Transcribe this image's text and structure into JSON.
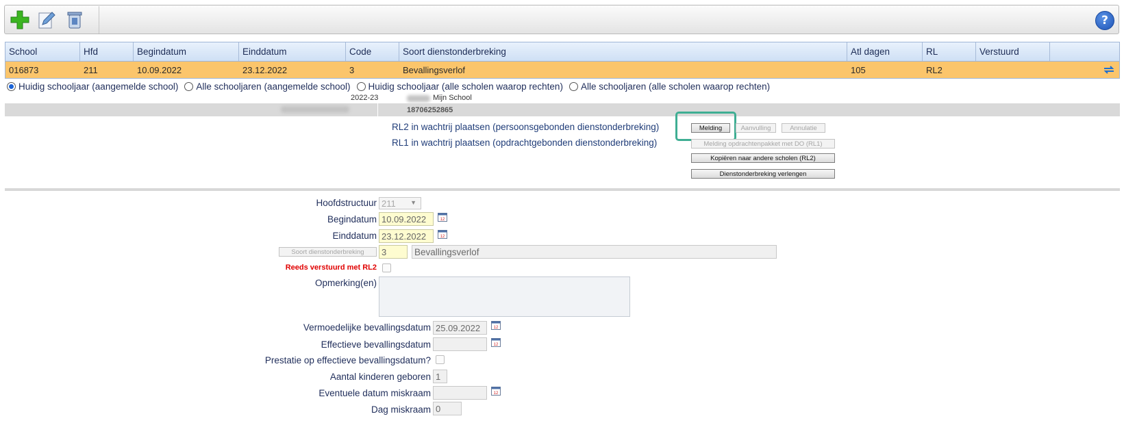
{
  "toolbar": {
    "icons": [
      "add-icon",
      "edit-icon",
      "delete-icon"
    ],
    "help_label": "?"
  },
  "grid": {
    "columns": [
      "School",
      "Hfd",
      "Begindatum",
      "Einddatum",
      "Code",
      "Soort dienstonderbreking",
      "Atl dagen",
      "RL",
      "Verstuurd"
    ],
    "row": [
      "016873",
      "211",
      "10.09.2022",
      "23.12.2022",
      "3",
      "Bevallingsverlof",
      "105",
      "RL2",
      ""
    ]
  },
  "filters": [
    {
      "label": "Huidig schooljaar (aangemelde school)",
      "selected": true
    },
    {
      "label": "Alle schooljaren (aangemelde school)",
      "selected": false
    },
    {
      "label": "Huidig schooljaar (alle scholen waarop rechten)",
      "selected": false
    },
    {
      "label": "Alle schooljaren (alle scholen waarop rechten)",
      "selected": false
    }
  ],
  "info": {
    "year": "2022-23",
    "school": "Mijn School",
    "number": "18706252865"
  },
  "actions": {
    "rl2_label": "RL2 in wachtrij plaatsen (persoonsgebonden dienstonderbreking)",
    "rl1_label": "RL1 in wachtrij plaatsen (opdrachtgebonden dienstonderbreking)",
    "melding": "Melding",
    "aanvulling": "Aanvulling",
    "annulatie": "Annulatie",
    "melding_rl1": "Melding opdrachtenpakket met DO (RL1)",
    "kopieren": "Kopiëren naar andere scholen (RL2)",
    "verlengen": "Dienstonderbreking verlengen"
  },
  "form": {
    "hoofdstructuur_label": "Hoofdstructuur",
    "hoofdstructuur_value": "211",
    "begindatum_label": "Begindatum",
    "begindatum_value": "10.09.2022",
    "einddatum_label": "Einddatum",
    "einddatum_value": "23.12.2022",
    "soort_button": "Soort dienstonderbreking",
    "soort_code": "3",
    "soort_name": "Bevallingsverlof",
    "reeds_label": "Reeds verstuurd met RL2",
    "opmerking_label": "Opmerking(en)",
    "vermoedelijke_label": "Vermoedelijke bevallingsdatum",
    "vermoedelijke_value": "25.09.2022",
    "effectieve_label": "Effectieve bevallingsdatum",
    "effectieve_value": "",
    "prestatie_label": "Prestatie op effectieve bevallingsdatum?",
    "kinderen_label": "Aantal kinderen geboren",
    "kinderen_value": "1",
    "miskraam_datum_label": "Eventuele datum miskraam",
    "miskraam_datum_value": "",
    "dag_miskraam_label": "Dag miskraam",
    "dag_miskraam_value": "0",
    "calendar_icon": "calendar-icon"
  },
  "colors": {
    "row_highlight": "#fbc56b",
    "header_bg": "#d6e5f7",
    "field_yellow": "#fefcd0",
    "required_red": "#e00000",
    "highlight_box": "#3fae93"
  }
}
